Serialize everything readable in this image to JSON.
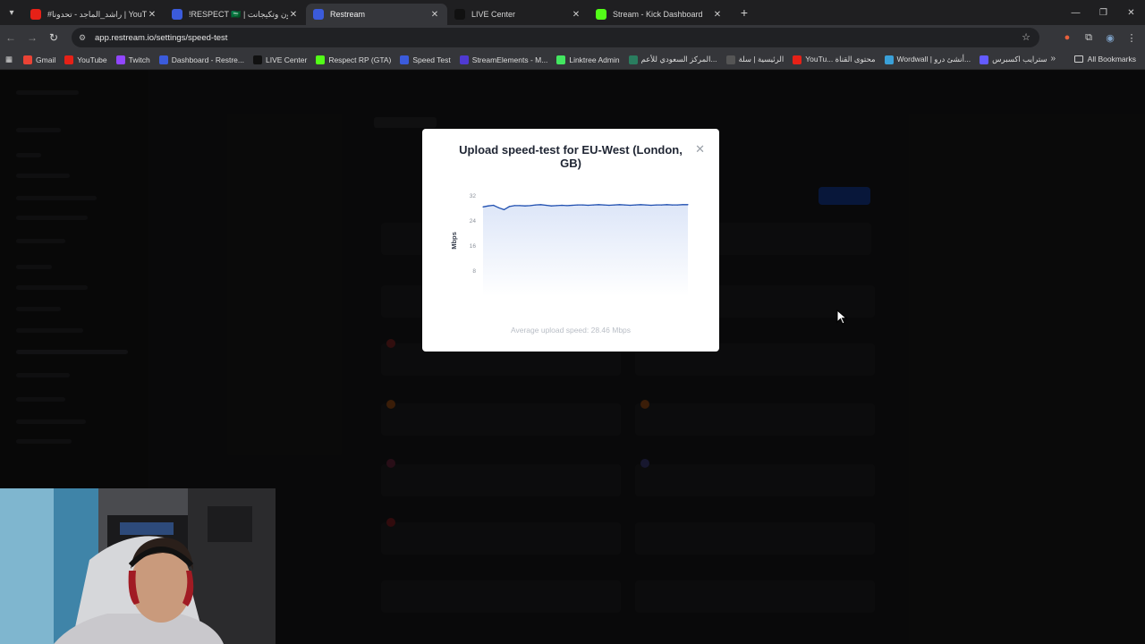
{
  "tabs": [
    {
      "title": "#راشد_الماجد - تحدونا | YouTube",
      "favicon": "youtube-icon",
      "color": "#e62117",
      "active": false
    },
    {
      "title": "!RESPECT 🇸🇦 | رايكوون وتكيجانت",
      "favicon": "restream-icon",
      "color": "#3b5bdb",
      "active": false
    },
    {
      "title": "Restream",
      "favicon": "restream-icon",
      "color": "#3b5bdb",
      "active": true
    },
    {
      "title": "LIVE Center",
      "favicon": "tiktok-icon",
      "color": "#111111",
      "active": false
    },
    {
      "title": "Stream - Kick Dashboard",
      "favicon": "kick-icon",
      "color": "#53fc18",
      "active": false
    }
  ],
  "address": {
    "url": "app.restream.io/settings/speed-test"
  },
  "bookmarks": [
    {
      "label": "Gmail",
      "icon": "gmail-icon",
      "color": "#ea4335"
    },
    {
      "label": "YouTube",
      "icon": "youtube-icon",
      "color": "#e62117"
    },
    {
      "label": "Twitch",
      "icon": "twitch-icon",
      "color": "#9146ff"
    },
    {
      "label": "Dashboard - Restre...",
      "icon": "restream-icon",
      "color": "#3b5bdb"
    },
    {
      "label": "LIVE Center",
      "icon": "tiktok-icon",
      "color": "#111111"
    },
    {
      "label": "Respect RP (GTA)",
      "icon": "kick-icon",
      "color": "#53fc18"
    },
    {
      "label": "Speed Test",
      "icon": "restream-icon",
      "color": "#3b5bdb"
    },
    {
      "label": "StreamElements - M...",
      "icon": "streamelements-icon",
      "color": "#4f3ad1"
    },
    {
      "label": "Linktree Admin",
      "icon": "linktree-icon",
      "color": "#43e660"
    },
    {
      "label": "المركز السعودي للأعم...",
      "icon": "page-icon",
      "color": "#2a7d5f"
    },
    {
      "label": "الرئيسية | سلة",
      "icon": "salla-icon",
      "color": "#555555"
    },
    {
      "label": "YouTu... محتوى القناة",
      "icon": "youtube-icon",
      "color": "#e62117"
    },
    {
      "label": "Wordwall | أنشئ درو...",
      "icon": "wordwall-icon",
      "color": "#3aa0d8"
    },
    {
      "label": "سترايب اكسبرس",
      "icon": "stripe-icon",
      "color": "#635bff"
    }
  ],
  "all_bookmarks_label": "All Bookmarks",
  "modal": {
    "title": "Upload speed-test for EU-West (London, GB)",
    "average": "Average upload speed: 28.46 Mbps"
  },
  "chart_data": {
    "type": "area",
    "title": "Upload speed-test for EU-West (London, GB)",
    "ylabel": "Mbps",
    "xlabel": "",
    "ylim": [
      0,
      32
    ],
    "yticks": [
      8,
      16,
      24,
      32
    ],
    "grid": false,
    "color": "#1f4fb0",
    "fill": "#dde6f8",
    "values": [
      28.5,
      28.8,
      29.0,
      28.2,
      27.6,
      28.6,
      28.9,
      28.9,
      28.8,
      28.9,
      29.1,
      29.2,
      29.0,
      28.8,
      28.9,
      29.0,
      28.9,
      29.0,
      29.1,
      29.1,
      29.0,
      29.1,
      29.2,
      29.1,
      29.0,
      29.1,
      29.2,
      29.1,
      29.0,
      29.1,
      29.2,
      29.1,
      29.0,
      29.1,
      29.1,
      29.2,
      29.1,
      29.1,
      29.2,
      29.2
    ]
  }
}
